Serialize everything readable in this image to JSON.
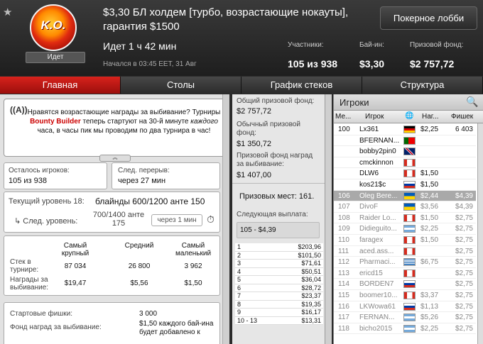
{
  "header": {
    "status": "Идет",
    "title": "$3,30 БЛ холдем [турбо, возрастающие нокауты], гарантия $1500",
    "lobby_button": "Покерное лобби",
    "running": "Идет 1 ч 42 мин",
    "started": "Начался в 03:45 EET, 31 Авг",
    "participants_label": "Участники:",
    "participants_value": "105 из 938",
    "buyin_label": "Бай-ин:",
    "buyin_value": "$3,30",
    "prize_label": "Призовой фонд:",
    "prize_value": "$2 757,72",
    "logo_text": "K.O."
  },
  "tabs": [
    {
      "label": "Главная"
    },
    {
      "label": "Столы"
    },
    {
      "label": "График стеков"
    },
    {
      "label": "Структура"
    }
  ],
  "promo": {
    "part1": "Нравятся возрастающие награды за выбивание? Турниры ",
    "brand": "Bounty Builder",
    "part2": " теперь стартуют на 30-й минуте ",
    "emph": "каждого",
    "part3": " часа, в часы пик мы проводим по два турнира в час!"
  },
  "remaining": {
    "label": "Осталось игроков:",
    "value": "105 из 938"
  },
  "next_break": {
    "label": "След. перерыв:",
    "value": "через 27 мин"
  },
  "level": {
    "current": "Текущий уровень 18:",
    "blinds": "блайнды 600/1200 анте 150",
    "next_label": "След. уровень:",
    "next_value": "700/1400 анте 175",
    "next_time": "через 1 мин"
  },
  "stacks": {
    "col_largest": "Самый крупный",
    "col_average": "Средний",
    "col_smallest": "Самый маленький",
    "row1_label": "Стек в турнире:",
    "row1": [
      "87 034",
      "26 800",
      "3 962"
    ],
    "row2_label": "Награды за выбивание:",
    "row2": [
      "$19,47",
      "$5,56",
      "$1,50"
    ]
  },
  "info": {
    "chips_label": "Стартовые фишки:",
    "chips_value": "3 000",
    "ko_label": "Фонд наград за выбивание:",
    "ko_value": "$1,50 каждого бай-ина будет добавлено к"
  },
  "prizes": {
    "total_label": "Общий призовой фонд:",
    "total": "$2 757,72",
    "regular_label": "Обычный призовой фонд:",
    "regular": "$1 350,72",
    "ko_label": "Призовой фонд наград за выбивание:",
    "ko": "$1 407,00",
    "paid": "Призовых мест: 161.",
    "next_label": "Следующая выплата:",
    "next_value": "105 - $4,39"
  },
  "payouts": [
    {
      "place": "1",
      "amount": "$203,96"
    },
    {
      "place": "2",
      "amount": "$101,50"
    },
    {
      "place": "3",
      "amount": "$71,61"
    },
    {
      "place": "4",
      "amount": "$50,51"
    },
    {
      "place": "5",
      "amount": "$36,04"
    },
    {
      "place": "6",
      "amount": "$28,72"
    },
    {
      "place": "7",
      "amount": "$23,37"
    },
    {
      "place": "8",
      "amount": "$19,35"
    },
    {
      "place": "9",
      "amount": "$16,17"
    },
    {
      "place": "10 - 13",
      "amount": "$13,31"
    }
  ],
  "players_panel": {
    "title": "Игроки",
    "col_place": "Ме...",
    "col_player": "Игрок",
    "col_ko": "Наг...",
    "col_chips": "Фишек",
    "rows": [
      {
        "place": "100",
        "name": "Lx361",
        "ko": "$2,25",
        "chips": "6 403",
        "flag": "de",
        "state": "normal"
      },
      {
        "place": "",
        "name": "BFERNAN...",
        "ko": "",
        "chips": "",
        "flag": "pt",
        "state": "normal"
      },
      {
        "place": "",
        "name": "bobby2pin0",
        "ko": "",
        "chips": "",
        "flag": "gb",
        "state": "normal"
      },
      {
        "place": "",
        "name": "cmckinnon",
        "ko": "",
        "chips": "",
        "flag": "ca",
        "state": "normal"
      },
      {
        "place": "",
        "name": "DLW6",
        "ko": "$1,50",
        "chips": "",
        "flag": "ca",
        "state": "normal"
      },
      {
        "place": "",
        "name": "kos21$c",
        "ko": "$1,50",
        "chips": "",
        "flag": "ru",
        "state": "normal"
      },
      {
        "place": "106",
        "name": "Oleg Bere...",
        "ko": "$2,44",
        "chips": "$4,39",
        "flag": "ua",
        "state": "selected"
      },
      {
        "place": "107",
        "name": "DivoF",
        "ko": "$3,56",
        "chips": "$4,39",
        "flag": "ua",
        "state": "grey"
      },
      {
        "place": "108",
        "name": "Raider Lo...",
        "ko": "$1,50",
        "chips": "$2,75",
        "flag": "ca",
        "state": "grey"
      },
      {
        "place": "109",
        "name": "Didieguito...",
        "ko": "$2,25",
        "chips": "$2,75",
        "flag": "ar",
        "state": "grey"
      },
      {
        "place": "110",
        "name": "faragex",
        "ko": "$1,50",
        "chips": "$2,75",
        "flag": "ca",
        "state": "grey"
      },
      {
        "place": "111",
        "name": "aced.ass...",
        "ko": "",
        "chips": "$2,75",
        "flag": "ca",
        "state": "grey"
      },
      {
        "place": "112",
        "name": "Pharmaci...",
        "ko": "$6,75",
        "chips": "$2,75",
        "flag": "gr",
        "state": "grey"
      },
      {
        "place": "113",
        "name": "ericd15",
        "ko": "",
        "chips": "$2,75",
        "flag": "ca",
        "state": "grey"
      },
      {
        "place": "114",
        "name": "BORDEN7",
        "ko": "",
        "chips": "$2,75",
        "flag": "ru",
        "state": "grey"
      },
      {
        "place": "115",
        "name": "boomer10...",
        "ko": "$3,37",
        "chips": "$2,75",
        "flag": "ca",
        "state": "grey"
      },
      {
        "place": "116",
        "name": "LKWowa61",
        "ko": "$1,13",
        "chips": "$2,75",
        "flag": "ru",
        "state": "grey"
      },
      {
        "place": "117",
        "name": "FERNAN...",
        "ko": "$5,26",
        "chips": "$2,75",
        "flag": "ar",
        "state": "grey"
      },
      {
        "place": "118",
        "name": "bicho2015",
        "ko": "$2,25",
        "chips": "$2,75",
        "flag": "ar",
        "state": "grey"
      }
    ]
  },
  "colors": {
    "accent_red": "#c81e19",
    "header_bg": "#2a2a2a",
    "selected_row": "#a9a9a9"
  }
}
